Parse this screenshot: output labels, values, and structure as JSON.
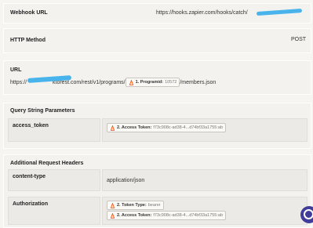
{
  "webhook": {
    "label": "Webhook URL",
    "value": "https://hooks.zapier.com/hooks/catch/"
  },
  "method": {
    "label": "HTTP Method",
    "value": "POST"
  },
  "url": {
    "label": "URL",
    "prefix": "https://",
    "mid": "ktorest.com/rest/v1/programs/",
    "chip_name": "1. Programid:",
    "chip_value": "10572",
    "suffix": "/members.json"
  },
  "query": {
    "title": "Query String Parameters",
    "key": "access_token",
    "chip_name": "2. Access Token:",
    "chip_value": "f73c908c-ad38-4...d74bf33a1755:ab"
  },
  "headers": {
    "title": "Additional Request Headers",
    "rows": [
      {
        "key": "content-type",
        "value": "application/json"
      },
      {
        "key": "Authorization",
        "chip1_name": "2. Token Type:",
        "chip1_value": "bearer",
        "chip2_name": "2. Access Token:",
        "chip2_value": "f73c908c-ad38-4...d74bf33a1755:ab"
      }
    ]
  },
  "colors": {
    "accent": "#3f3d99",
    "zap_orange": "#ff4a00",
    "redaction": "#3fb0ea"
  }
}
